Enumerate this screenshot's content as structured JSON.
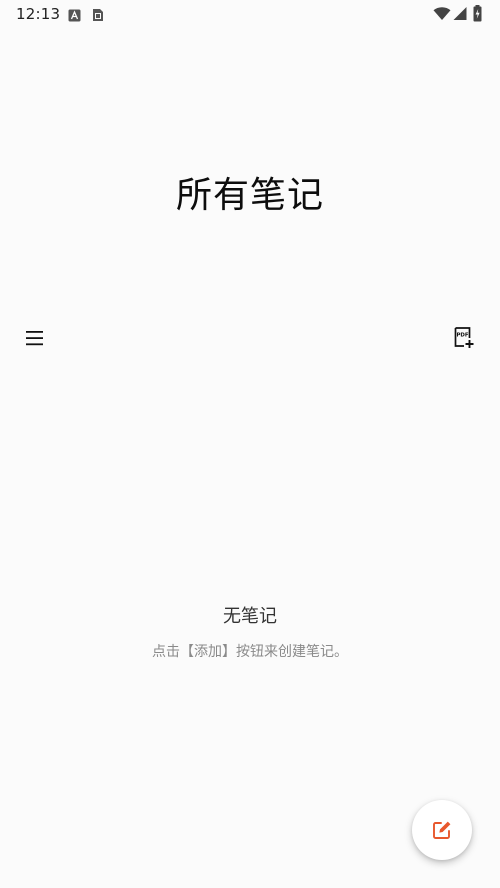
{
  "status_bar": {
    "time": "12:13",
    "left_icons": [
      "keyboard-a-icon",
      "sim-card-icon"
    ],
    "right_icons": [
      "wifi-icon",
      "cellular-signal-icon",
      "battery-charging-icon"
    ]
  },
  "header": {
    "title": "所有笔记",
    "menu_icon": "hamburger-menu-icon",
    "pdf_icon": "pdf-add-icon"
  },
  "empty_state": {
    "title": "无笔记",
    "hint": "点击【添加】按钮来创建笔记。"
  },
  "fab": {
    "icon": "edit-note-icon",
    "accent": "#e8572c"
  },
  "colors": {
    "background": "#fbfbfb",
    "title": "#0d0d0d",
    "hint": "#8a8a8a"
  }
}
